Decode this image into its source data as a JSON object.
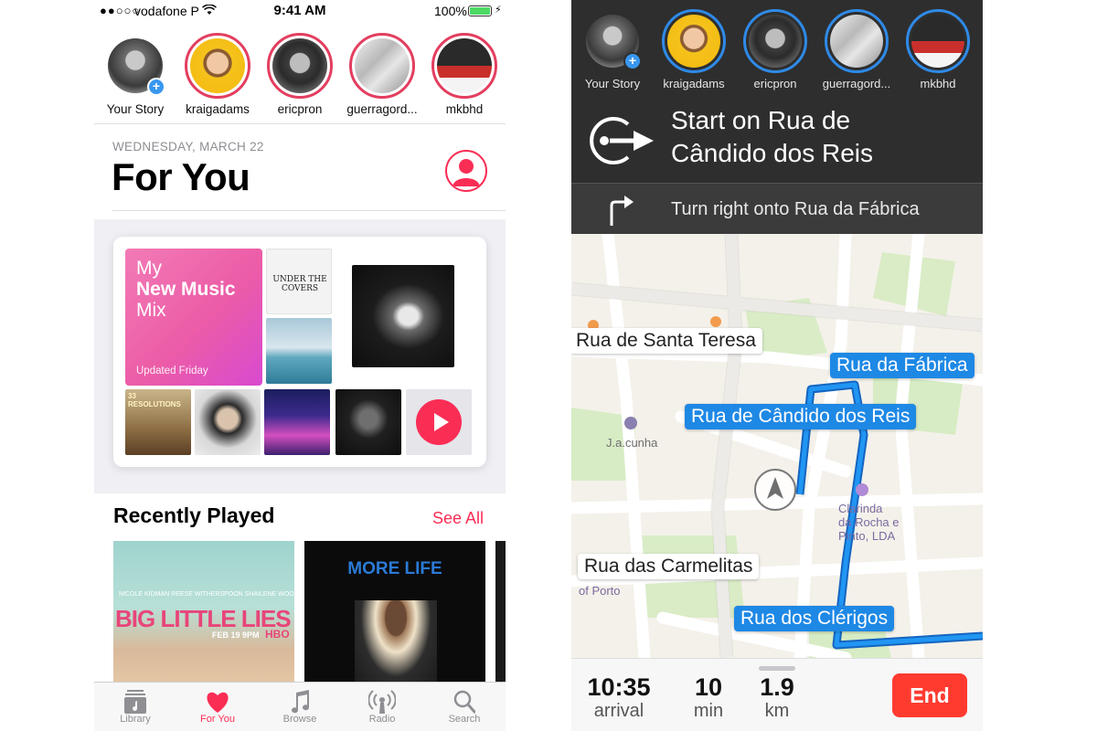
{
  "left": {
    "status": {
      "signal": "●●○○○",
      "carrier": "vodafone P",
      "time": "9:41 AM",
      "battery": "100%"
    },
    "stories": [
      {
        "name": "Your Story"
      },
      {
        "name": "kraigadams"
      },
      {
        "name": "ericpron"
      },
      {
        "name": "guerragord..."
      },
      {
        "name": "mkbhd"
      }
    ],
    "date": "WEDNESDAY, MARCH 22",
    "title": "For You",
    "mix": {
      "line1": "My",
      "line2": "New Music",
      "line3": "Mix",
      "updated": "Updated Friday"
    },
    "covers": {
      "under_covers": "UNDER THE COVERS",
      "resolutions": "33 RESOLUTIONS"
    },
    "recently_played": {
      "title": "Recently Played",
      "see_all": "See All"
    },
    "albums": {
      "a1": {
        "names": "NICOLE KIDMAN   REESE WITHERSPOON   SHAILENE WOODLEY",
        "title": "BIG LITTLE LIES",
        "date": "FEB 19 9PM",
        "network": "HBO"
      },
      "a2": {
        "title": "MORE LIFE"
      }
    },
    "tabs": [
      {
        "label": "Library",
        "icon": "library-icon"
      },
      {
        "label": "For You",
        "icon": "heart-icon",
        "active": true
      },
      {
        "label": "Browse",
        "icon": "music-note-icon"
      },
      {
        "label": "Radio",
        "icon": "radio-icon"
      },
      {
        "label": "Search",
        "icon": "search-icon"
      }
    ],
    "accent": "#fa2d55"
  },
  "right": {
    "stories": [
      {
        "name": "Your Story"
      },
      {
        "name": "kraigadams"
      },
      {
        "name": "ericpron"
      },
      {
        "name": "guerragord..."
      },
      {
        "name": "mkbhd"
      }
    ],
    "nav": {
      "primary_line1": "Start on Rua de",
      "primary_line2": "Cândido dos Reis",
      "secondary": "Turn right onto Rua da Fábrica"
    },
    "map_labels": {
      "santa_teresa": "Rua de Santa Teresa",
      "fabrica": "Rua da Fábrica",
      "candido": "Rua de Cândido dos Reis",
      "carmelitas": "Rua das Carmelitas",
      "clerigos": "Rua dos Clérigos"
    },
    "pois": {
      "ja_cunha": "J.a.cunha",
      "clarinda_1": "Clarinda",
      "clarinda_2": "da Rocha e",
      "clarinda_3": "Pinto, LDA",
      "university": "of Porto"
    },
    "trip": {
      "arrival_value": "10:35",
      "arrival_unit": "arrival",
      "min_value": "10",
      "min_unit": "min",
      "km_value": "1.9",
      "km_unit": "km",
      "end": "End"
    },
    "route_color": "#1e88e5"
  }
}
